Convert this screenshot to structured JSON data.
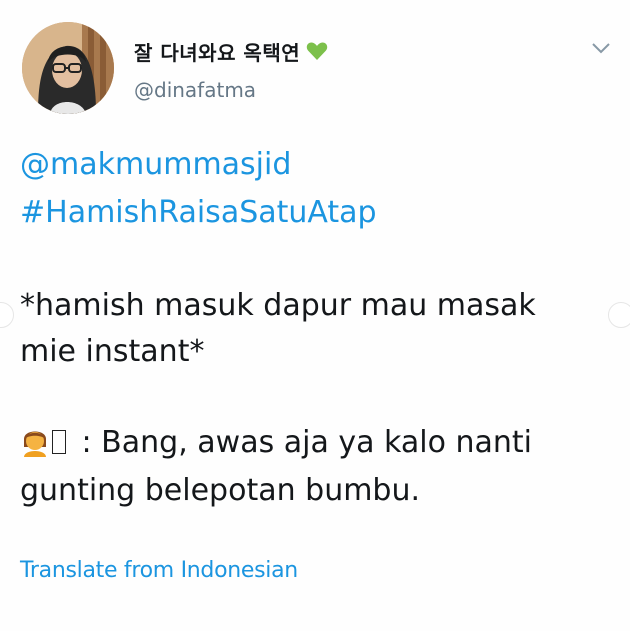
{
  "author": {
    "display_name": "잘 다녀와요 옥택연",
    "handle": "@dinafatma"
  },
  "icons": {
    "verified_heart": "green-heart-icon",
    "menu": "chevron-down-icon",
    "emoji": "person-emoji-icon",
    "heart_color": "#7cc04b"
  },
  "tweet": {
    "mention": "@makmummasjid",
    "hashtag": "#HamishRaisaSatuAtap",
    "line1": "*hamish masuk dapur mau masak",
    "line2": "mie instant*",
    "dialogue_line1": " : Bang, awas aja ya kalo nanti",
    "dialogue_line2": "gunting belepotan bumbu."
  },
  "translate_label": "Translate from Indonesian",
  "colors": {
    "link": "#1b95e0",
    "text": "#14171a",
    "handle": "#657786"
  }
}
